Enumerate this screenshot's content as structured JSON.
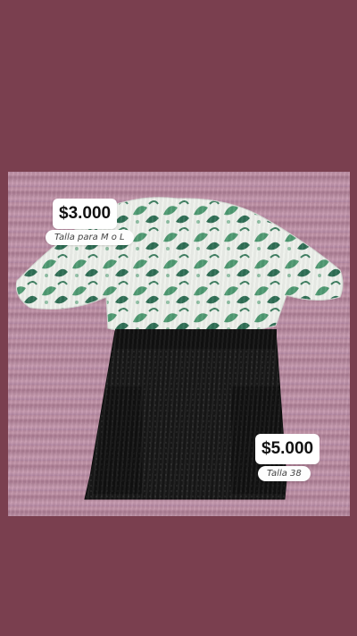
{
  "story": {
    "items": [
      {
        "price": "$3.000",
        "note": "Talla para  M o L"
      },
      {
        "price": "$5.000",
        "note": "Talla 38"
      }
    ],
    "colors": {
      "background": "#7a3f4f",
      "blanket": "#b98da2",
      "blouse_print": "#4f9a72",
      "skirt": "#151515"
    }
  }
}
